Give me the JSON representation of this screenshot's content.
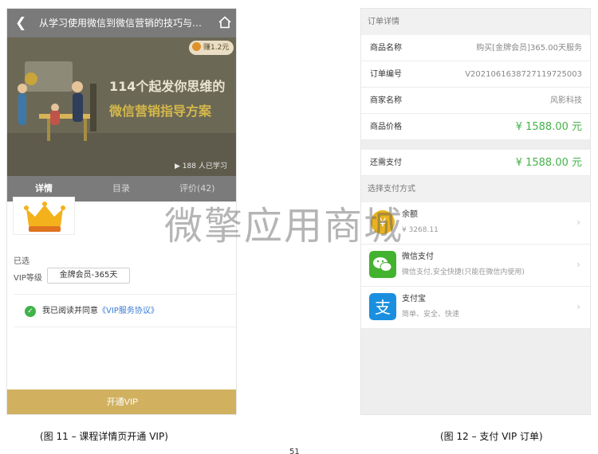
{
  "left_screen": {
    "header_title": "从学习使用微信到微信营销的技巧与…",
    "earn_badge": "赚1.2元",
    "banner_line1": "114个起发你思维的",
    "banner_line2": "微信营销指导方案",
    "learners": "▶ 188 人已学习",
    "tabs": [
      {
        "label": "详情"
      },
      {
        "label": "目录"
      },
      {
        "label": "评价(42)"
      }
    ],
    "selected_label": "已选",
    "vip_label": "VIP等级",
    "vip_option": "金牌会员-365天",
    "agree_prefix": "我已阅读并同意",
    "agree_link": "《VIP服务协议》",
    "open_button": "开通VIP"
  },
  "right_screen": {
    "order_section": "订单详情",
    "rows": [
      {
        "label": "商品名称",
        "value": "购买[金牌会员]365.00天服务"
      },
      {
        "label": "订单编号",
        "value": "V2021061638727119725003"
      },
      {
        "label": "商家名称",
        "value": "风影科技"
      },
      {
        "label": "商品价格",
        "value": "¥ 1588.00 元"
      }
    ],
    "total_label": "还需支付",
    "total_value": "¥ 1588.00 元",
    "method_section": "选择支付方式",
    "methods": [
      {
        "name": "余额",
        "desc": "¥ 3268.11"
      },
      {
        "name": "微信支付",
        "desc": "微信支付,安全快捷(只能在微信内使用)"
      },
      {
        "name": "支付宝",
        "desc": "简单、安全、快速"
      }
    ]
  },
  "watermark": "微擎应用商城",
  "caption_left": "(图 11 – 课程详情页开通 VIP)",
  "caption_right": "(图 12 – 支付 VIP 订单)",
  "page_number": "51",
  "colors": {
    "accent_gold": "#d1b160",
    "price_green": "#45b24a",
    "link_blue": "#3579d6",
    "wechat_green": "#43b22f",
    "alipay_blue": "#1a8fe0"
  }
}
